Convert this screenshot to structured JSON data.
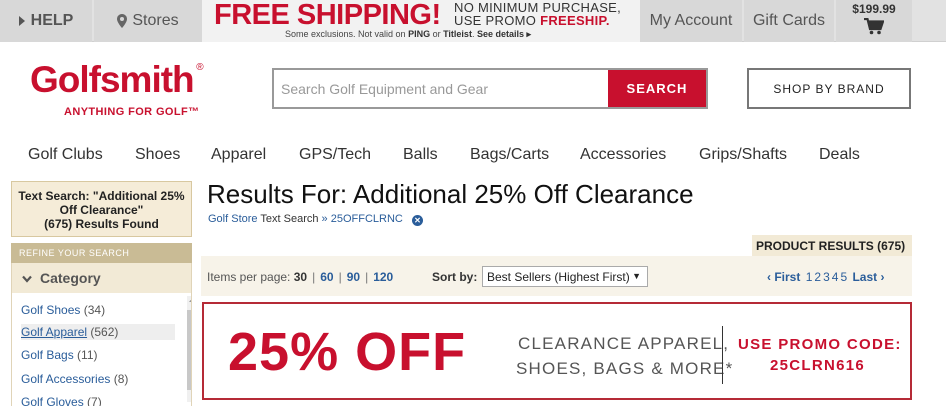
{
  "topbar": {
    "help": "HELP",
    "stores": "Stores",
    "promo_big": "FREE SHIPPING!",
    "promo_line1": "NO MINIMUM PURCHASE,",
    "promo_line2_prefix": "USE PROMO ",
    "promo_code": "FREESHIP.",
    "exclusions_prefix": "Some exclusions. Not valid on ",
    "exclusions_brand1": "PING",
    "exclusions_or": " or ",
    "exclusions_brand2": "Titleist",
    "exclusions_suffix": ". ",
    "see_details": "See details ▸",
    "my_account": "My Account",
    "gift_cards": "Gift Cards",
    "cart_total": "$199.99"
  },
  "header": {
    "logo": "Golfsmith",
    "logo_reg": "®",
    "tagline": "ANYTHING FOR GOLF™",
    "search_placeholder": "Search Golf Equipment and Gear",
    "search_button": "SEARCH",
    "shop_by_brand": "SHOP BY BRAND"
  },
  "nav": [
    "Golf Clubs",
    "Shoes",
    "Apparel",
    "GPS/Tech",
    "Balls",
    "Bags/Carts",
    "Accessories",
    "Grips/Shafts",
    "Deals"
  ],
  "sidebar": {
    "text_search_line1": "Text Search: \"Additional 25%",
    "text_search_line2": "Off Clearance\"",
    "text_search_line3": "(675) Results Found",
    "refine": "REFINE YOUR SEARCH",
    "category": "Category",
    "categories": [
      {
        "label": "Golf Shoes",
        "count": "(34)"
      },
      {
        "label": "Golf Apparel",
        "count": "(562)"
      },
      {
        "label": "Golf Bags",
        "count": "(11)"
      },
      {
        "label": "Golf Accessories",
        "count": "(8)"
      },
      {
        "label": "Golf Gloves",
        "count": "(7)"
      }
    ]
  },
  "results": {
    "title": "Results For: Additional 25% Off Clearance",
    "crumb_store": "Golf Store",
    "crumb_text": "Text Search",
    "crumb_sep": "»",
    "crumb_code": "25OFFCLRNC",
    "tab": "PRODUCT RESULTS (675)",
    "items_per_page_label": "Items per page:",
    "ipp_current": "30",
    "ipp_options": [
      "60",
      "90",
      "120"
    ],
    "sort_label": "Sort by:",
    "sort_value": "Best Sellers (Highest First)",
    "pager_first": "‹ First",
    "pages": [
      "1",
      "2",
      "3",
      "4",
      "5"
    ],
    "pager_last": "Last ›"
  },
  "banner": {
    "pct": "25% OFF",
    "line1": "CLEARANCE APPAREL,",
    "line2": "SHOES, BAGS & MORE*",
    "use_code": "USE PROMO CODE:",
    "code": "25CLRN616"
  },
  "colors": {
    "brand_red": "#c8102e",
    "link_blue": "#2a5d9a",
    "sidebar_tan": "#f5ecd8"
  }
}
